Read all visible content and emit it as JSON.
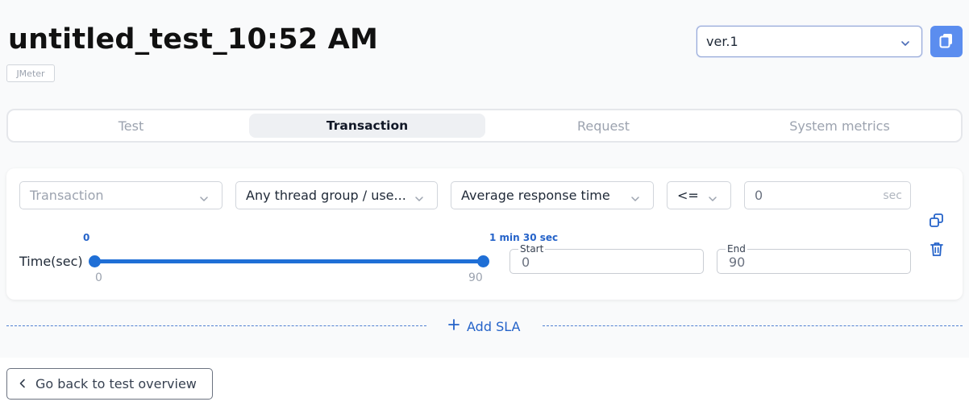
{
  "header": {
    "title": "untitled_test_10:52 AM",
    "tag": "JMeter",
    "version_select": {
      "value": "ver.1",
      "icon": "chevron-down-icon"
    },
    "copy_button_icon": "copy-icon"
  },
  "tabs": [
    {
      "label": "Test",
      "active": false
    },
    {
      "label": "Transaction",
      "active": true
    },
    {
      "label": "Request",
      "active": false
    },
    {
      "label": "System metrics",
      "active": false
    }
  ],
  "sla": {
    "transaction_select": {
      "placeholder": "Transaction"
    },
    "thread_group_select": {
      "value": "Any thread group / use..."
    },
    "metric_select": {
      "value": "Average response time"
    },
    "operator_select": {
      "value": "<="
    },
    "threshold_input": {
      "value": "0",
      "unit": "sec"
    },
    "time": {
      "label": "Time(sec)",
      "min": 0,
      "max": 90,
      "range_start": 0,
      "range_end": 90,
      "start_display": "0",
      "end_display": "1 min 30 sec",
      "min_label": "0",
      "max_label": "90",
      "start_field": {
        "label": "Start",
        "value": "0"
      },
      "end_field": {
        "label": "End",
        "value": "90"
      }
    },
    "actions": {
      "duplicate_icon": "duplicate-icon",
      "delete_icon": "trash-icon"
    }
  },
  "add_sla": {
    "label": "Add SLA",
    "icon": "plus-icon"
  },
  "footer": {
    "back_button": {
      "label": "Go back to test overview",
      "icon": "chevron-left-icon"
    }
  },
  "colors": {
    "accent": "#1f6fd6",
    "copy_button": "#5b8def"
  }
}
